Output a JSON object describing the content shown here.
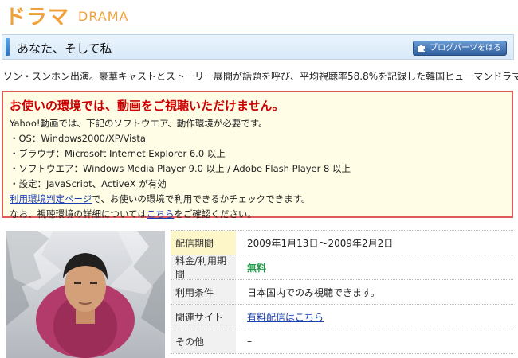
{
  "header": {
    "title_jp": "ドラマ",
    "title_en": "DRAMA"
  },
  "program": {
    "title": "あなた、そして私",
    "blog_button": "ブログパーツをはる",
    "description": "ソン・スンホン出演。豪華キャストとストーリー展開が話題を呼び、平均視聴率58.8%を記録した韓国ヒューマンドラマ。"
  },
  "warning": {
    "heading": "お使いの環境では、動画をご視聴いただけません。",
    "lines": [
      "Yahoo!動画では、下記のソフトウエア、動作環境が必要です。",
      "・OS：Windows2000/XP/Vista",
      "・ブラウザ：Microsoft Internet Explorer 6.0 以上",
      "・ソフトウエア：Windows Media Player 9.0 以上 / Adobe Flash Player 8 以上",
      "・設定：JavaScript、ActiveX が有効"
    ],
    "check_link": "利用環境判定ページ",
    "check_rest": "で、お使いの環境で利用できるかチェックできます。",
    "detail_pre": "なお、視聴環境の詳細については",
    "detail_link": "こちら",
    "detail_post": "をご確認ください。"
  },
  "info": {
    "period_label": "配信期間",
    "period_value": "2009年1月13日～2009年2月2日",
    "fee_label": "料金/利用期間",
    "fee_value": "無料",
    "terms_label": "利用条件",
    "terms_value": "日本国内でのみ視聴できます。",
    "related_label": "関連サイト",
    "related_value": "有料配信はこちら",
    "other_label": "その他",
    "other_value": "–"
  },
  "colors": {
    "accent": "#f0a23a",
    "warning_border": "#e05a5a",
    "warning_text": "#cc0000",
    "free_text": "#219a4b"
  }
}
